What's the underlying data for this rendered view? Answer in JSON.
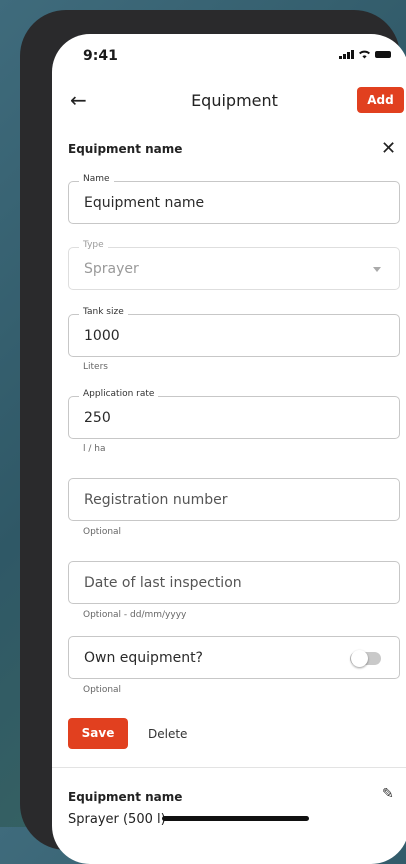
{
  "status": {
    "time": "9:41"
  },
  "header": {
    "title": "Equipment",
    "add_label": "Add"
  },
  "form": {
    "section_title": "Equipment name",
    "name": {
      "legend": "Name",
      "value": "Equipment name"
    },
    "type": {
      "legend": "Type",
      "value": "Sprayer"
    },
    "tank_size": {
      "legend": "Tank size",
      "value": "1000",
      "helper": "Liters"
    },
    "application_rate": {
      "legend": "Application rate",
      "value": "250",
      "helper": "l / ha"
    },
    "registration": {
      "placeholder": "Registration number",
      "helper": "Optional"
    },
    "inspection": {
      "placeholder": "Date of last inspection",
      "helper": "Optional - dd/mm/yyyy"
    },
    "own_equipment": {
      "label": "Own equipment?",
      "helper": "Optional",
      "checked": false
    },
    "save_label": "Save",
    "delete_label": "Delete"
  },
  "list": {
    "items": [
      {
        "title": "Equipment name",
        "subtitle": "Sprayer (500 l)"
      }
    ]
  },
  "icons": {
    "back": "arrow-left-icon",
    "close": "close-icon",
    "edit": "pencil-icon",
    "dropdown": "caret-down-icon"
  },
  "colors": {
    "accent": "#e1401f"
  }
}
